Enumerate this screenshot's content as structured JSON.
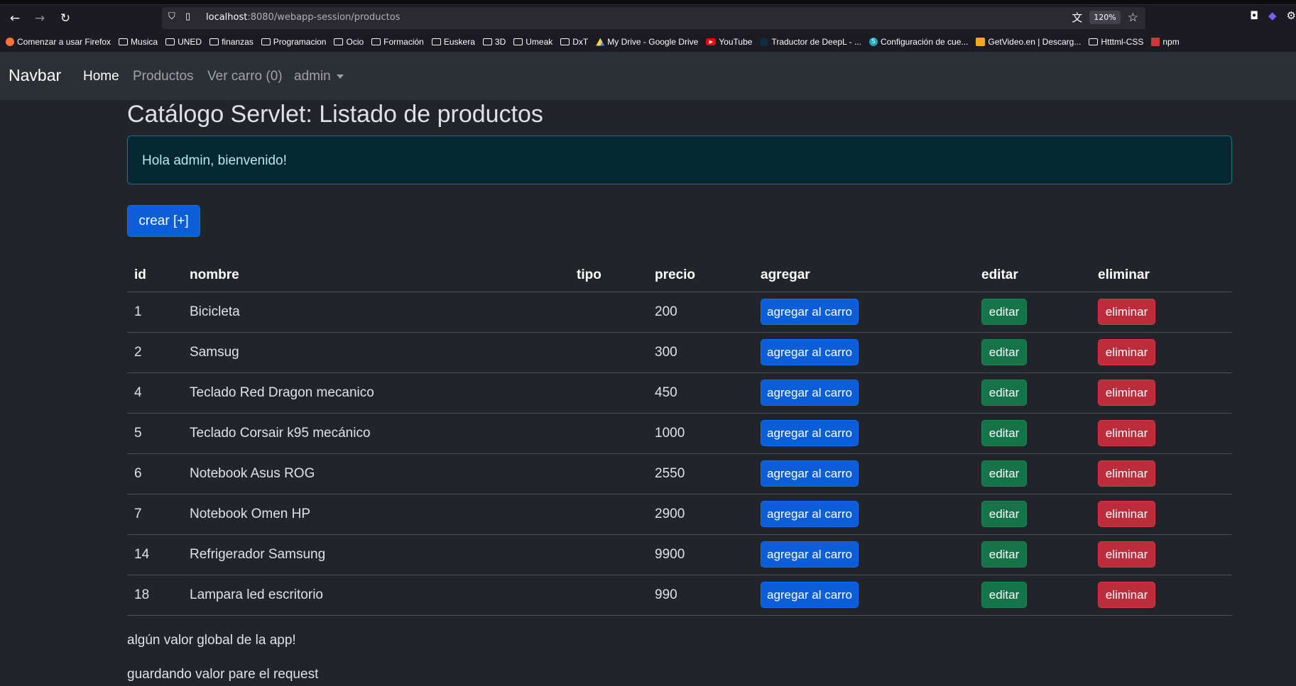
{
  "browser": {
    "url_host": "localhost",
    "url_rest": ":8080/webapp-session/productos",
    "zoom": "120%",
    "bookmarks": [
      {
        "icon": "firefox",
        "label": "Comenzar a usar Firefox"
      },
      {
        "icon": "folder",
        "label": "Musica"
      },
      {
        "icon": "folder",
        "label": "UNED"
      },
      {
        "icon": "folder",
        "label": "finanzas"
      },
      {
        "icon": "folder",
        "label": "Programacion"
      },
      {
        "icon": "folder",
        "label": "Ocio"
      },
      {
        "icon": "folder",
        "label": "Formación"
      },
      {
        "icon": "folder",
        "label": "Euskera"
      },
      {
        "icon": "folder",
        "label": "3D"
      },
      {
        "icon": "folder",
        "label": "Umeak"
      },
      {
        "icon": "folder",
        "label": "DxT"
      },
      {
        "icon": "drive",
        "label": "My Drive - Google Drive"
      },
      {
        "icon": "youtube",
        "label": "YouTube"
      },
      {
        "icon": "deepl",
        "label": "Traductor de DeepL - ..."
      },
      {
        "icon": "config",
        "label": "Configuración de cue..."
      },
      {
        "icon": "getvideo",
        "label": "GetVideo.en | Descarg..."
      },
      {
        "icon": "folder",
        "label": "Htttml-CSS"
      },
      {
        "icon": "npm",
        "label": "npm"
      }
    ]
  },
  "navbar": {
    "brand": "Navbar",
    "home": "Home",
    "productos": "Productos",
    "carro": "Ver carro (0)",
    "user": "admin"
  },
  "main": {
    "title": "Catálogo Servlet: Listado de productos",
    "alert": "Hola admin, bienvenido!",
    "create_label": "crear [+]",
    "columns": {
      "id": "id",
      "nombre": "nombre",
      "tipo": "tipo",
      "precio": "precio",
      "agregar": "agregar",
      "editar": "editar",
      "eliminar": "eliminar"
    },
    "add_label": "agregar al carro",
    "edit_label": "editar",
    "delete_label": "eliminar",
    "rows": [
      {
        "id": "1",
        "nombre": "Bicicleta",
        "tipo": "",
        "precio": "200"
      },
      {
        "id": "2",
        "nombre": "Samsug",
        "tipo": "",
        "precio": "300"
      },
      {
        "id": "4",
        "nombre": "Teclado Red Dragon mecanico",
        "tipo": "",
        "precio": "450"
      },
      {
        "id": "5",
        "nombre": "Teclado Corsair k95 mecánico",
        "tipo": "",
        "precio": "1000"
      },
      {
        "id": "6",
        "nombre": "Notebook Asus ROG",
        "tipo": "",
        "precio": "2550"
      },
      {
        "id": "7",
        "nombre": "Notebook Omen HP",
        "tipo": "",
        "precio": "2900"
      },
      {
        "id": "14",
        "nombre": "Refrigerador Samsung",
        "tipo": "",
        "precio": "9900"
      },
      {
        "id": "18",
        "nombre": "Lampara led escritorio",
        "tipo": "",
        "precio": "990"
      }
    ],
    "footer_global": "algún valor global de la app!",
    "footer_request": "guardando valor pare el request"
  }
}
